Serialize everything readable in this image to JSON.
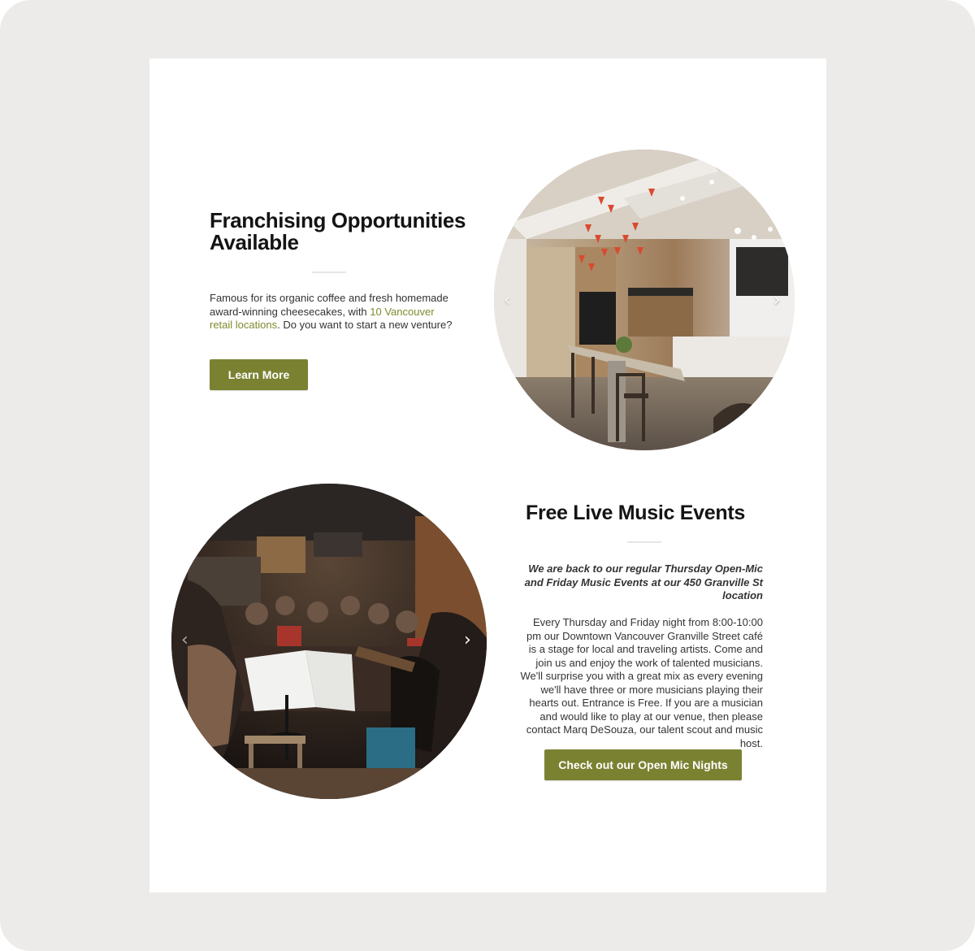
{
  "franchise": {
    "title": "Franchising Opportunities Available",
    "text_before_link": "Famous for its organic coffee and fresh homemade award-winning cheesecakes, with ",
    "link_text": "10 Vancouver retail locations",
    "text_after_link": ". Do you want to start a new venture?",
    "button_label": "Learn More"
  },
  "music": {
    "title": "Free Live Music Events",
    "lead": "We are back to our regular Thursday Open-Mic and Friday Music Events at our 450 Granville St location",
    "body": "Every Thursday and Friday night from 8:00-10:00 pm our Downtown Vancouver Granville Street café is a stage for local and traveling artists. Come and join us and enjoy the work of talented musicians. We'll surprise you with a great mix as every evening we'll have three or more musicians playing their hearts out. Entrance is Free. If you are a musician and would like to play at our venue, then please contact Marq DeSouza, our talent scout and music host.",
    "button_label": "Check out our Open Mic Nights"
  },
  "carousel": {
    "prev_icon": "‹",
    "next_icon": "›"
  },
  "colors": {
    "accent": "#7a8231",
    "link": "#808a2c",
    "background": "#ecebe9"
  }
}
